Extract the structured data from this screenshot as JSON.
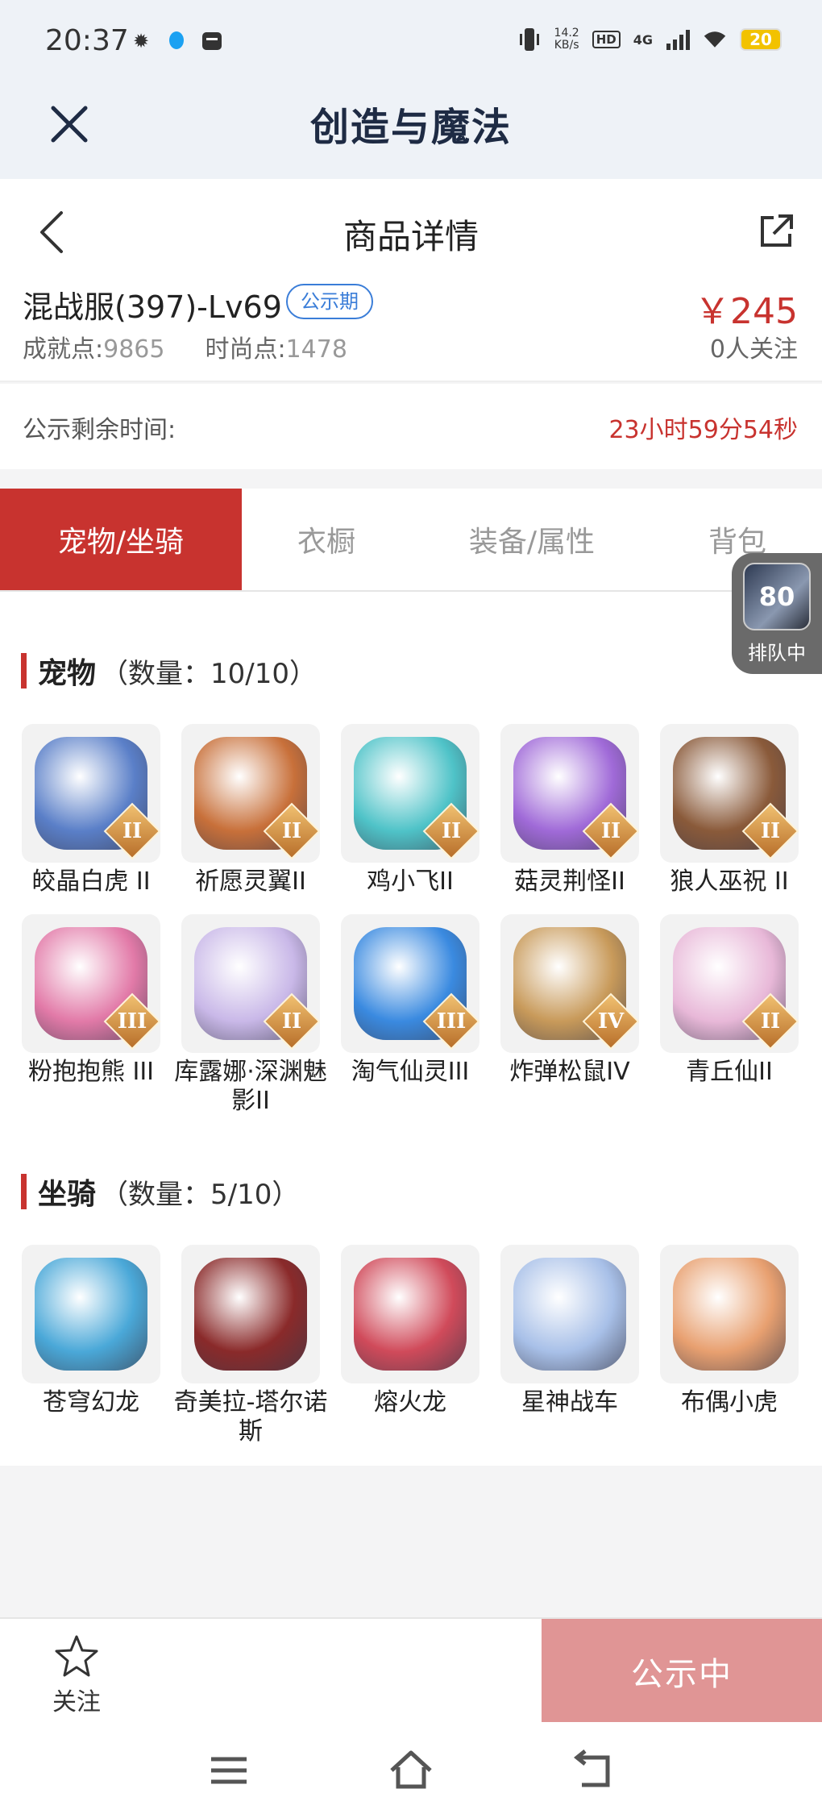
{
  "status_bar": {
    "time": "20:37",
    "speed_top": "14.2",
    "speed_bottom": "KB/s",
    "hd": "HD",
    "network": "4G",
    "battery": "20"
  },
  "app_bar": {
    "title": "创造与魔法"
  },
  "page_header": {
    "title": "商品详情"
  },
  "item": {
    "name": "混战服(397)-Lv69",
    "badge": "公示期",
    "price": "￥245",
    "achievement_label": "成就点:",
    "achievement_value": "9865",
    "fashion_label": "时尚点:",
    "fashion_value": "1478",
    "followers": "0人关注"
  },
  "countdown": {
    "label": "公示剩余时间:",
    "value": "23小时59分54秒"
  },
  "tabs": [
    {
      "label": "宠物/坐骑",
      "active": true
    },
    {
      "label": "衣橱",
      "active": false
    },
    {
      "label": "装备/属性",
      "active": false
    },
    {
      "label": "背包",
      "active": false
    }
  ],
  "queue": {
    "number": "80",
    "label": "排队中"
  },
  "pets": {
    "title": "宠物",
    "count": "（数量：10/10）",
    "items": [
      {
        "name": "皎晶白虎 II",
        "tier": "II",
        "color": "#5a7fc8"
      },
      {
        "name": "祈愿灵翼II",
        "tier": "II",
        "color": "#c8703a"
      },
      {
        "name": "鸡小飞II",
        "tier": "II",
        "color": "#4fc3c8"
      },
      {
        "name": "菇灵荆怪II",
        "tier": "II",
        "color": "#a06ad8"
      },
      {
        "name": "狼人巫祝 II",
        "tier": "II",
        "color": "#8a5a3a"
      },
      {
        "name": "粉抱抱熊 III",
        "tier": "III",
        "color": "#e27aa8"
      },
      {
        "name": "库露娜·深渊魅影II",
        "tier": "II",
        "color": "#c9b8e8"
      },
      {
        "name": "淘气仙灵III",
        "tier": "III",
        "color": "#3a8ae0"
      },
      {
        "name": "炸弹松鼠IV",
        "tier": "IV",
        "color": "#c89a5a"
      },
      {
        "name": "青丘仙II",
        "tier": "II",
        "color": "#e8b8d8"
      }
    ]
  },
  "mounts": {
    "title": "坐骑",
    "count": "（数量：5/10）",
    "items": [
      {
        "name": "苍穹幻龙",
        "color": "#4aa8d8"
      },
      {
        "name": "奇美拉-塔尔诺斯",
        "color": "#8a2a2a"
      },
      {
        "name": "熔火龙",
        "color": "#d04a5a"
      },
      {
        "name": "星神战车",
        "color": "#a8c0e8"
      },
      {
        "name": "布偶小虎",
        "color": "#e8a070"
      }
    ]
  },
  "action_bar": {
    "follow_label": "关注",
    "status_button": "公示中"
  }
}
